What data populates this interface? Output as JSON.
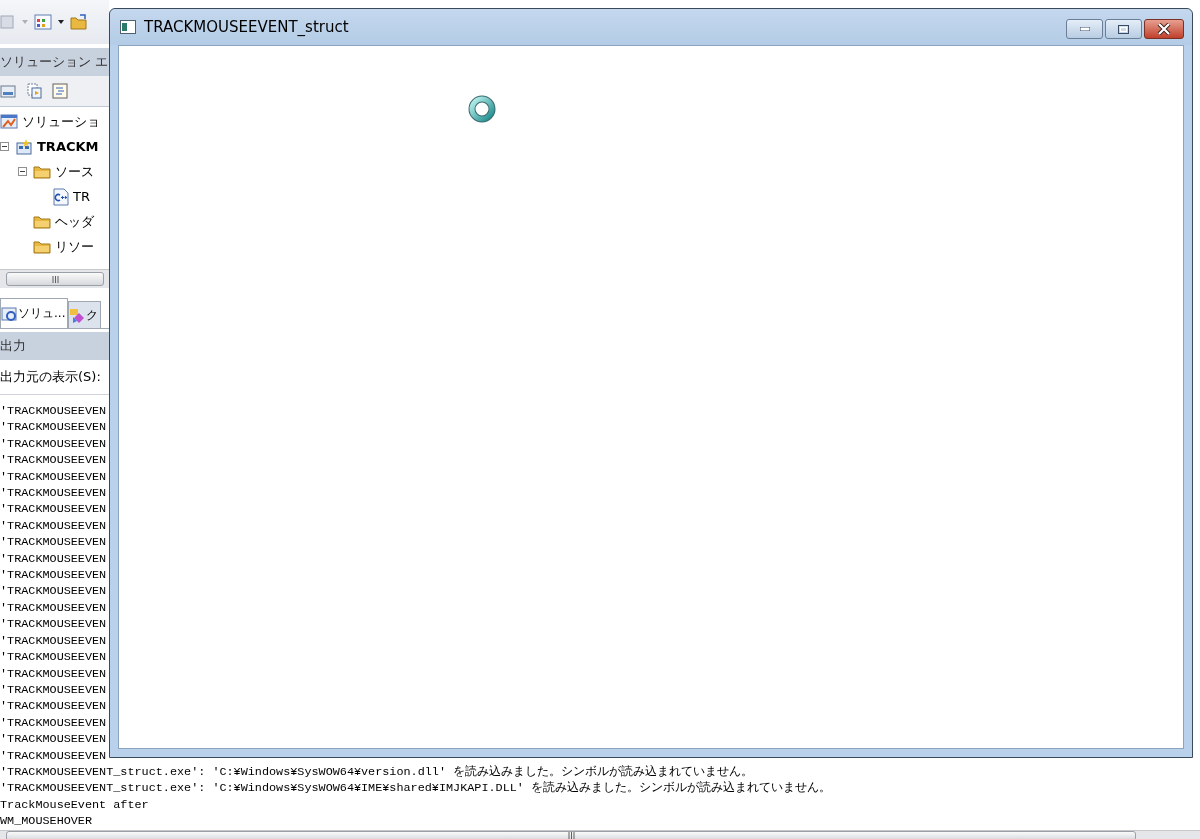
{
  "ide": {
    "solution_explorer": {
      "title": "ソリューション エ",
      "tree": [
        {
          "kind": "solution",
          "label": "ソリューショ",
          "children": [
            {
              "kind": "project",
              "label": "TRACKM",
              "bold": true,
              "expanded": true,
              "children": [
                {
                  "kind": "folder",
                  "label": "ソース",
                  "expanded": true,
                  "children": [
                    {
                      "kind": "cpp",
                      "label": "TR"
                    }
                  ]
                },
                {
                  "kind": "folder",
                  "label": "ヘッダ"
                },
                {
                  "kind": "folder",
                  "label": "リソー"
                }
              ]
            }
          ]
        }
      ]
    },
    "panel_tabs": [
      {
        "label": "ソリュ...",
        "kind": "solution",
        "selected": true
      },
      {
        "label": "ク",
        "kind": "classview",
        "selected": false
      }
    ],
    "output": {
      "title": "出力",
      "source_label": "出力元の表示(S):",
      "lines": [
        "'TRACKMOUSEEVEN",
        "'TRACKMOUSEEVEN",
        "'TRACKMOUSEEVEN",
        "'TRACKMOUSEEVEN",
        "'TRACKMOUSEEVEN",
        "'TRACKMOUSEEVEN",
        "'TRACKMOUSEEVEN",
        "'TRACKMOUSEEVEN",
        "'TRACKMOUSEEVEN",
        "'TRACKMOUSEEVEN",
        "'TRACKMOUSEEVEN",
        "'TRACKMOUSEEVEN",
        "'TRACKMOUSEEVEN",
        "'TRACKMOUSEEVEN",
        "'TRACKMOUSEEVEN",
        "'TRACKMOUSEEVEN",
        "'TRACKMOUSEEVEN",
        "'TRACKMOUSEEVEN",
        "'TRACKMOUSEEVEN",
        "'TRACKMOUSEEVEN",
        "'TRACKMOUSEEVEN",
        "'TRACKMOUSEEVEN",
        "'TRACKMOUSEEVENT_struct.exe': 'C:¥Windows¥SysWOW64¥version.dll' を読み込みました。シンボルが読み込まれていません。",
        "'TRACKMOUSEEVENT_struct.exe': 'C:¥Windows¥SysWOW64¥IME¥shared¥IMJKAPI.DLL' を読み込みました。シンボルが読み込まれていません。",
        "TrackMouseEvent after",
        "WM_MOUSEHOVER"
      ]
    }
  },
  "window": {
    "title": "TRACKMOUSEEVENT_struct"
  }
}
